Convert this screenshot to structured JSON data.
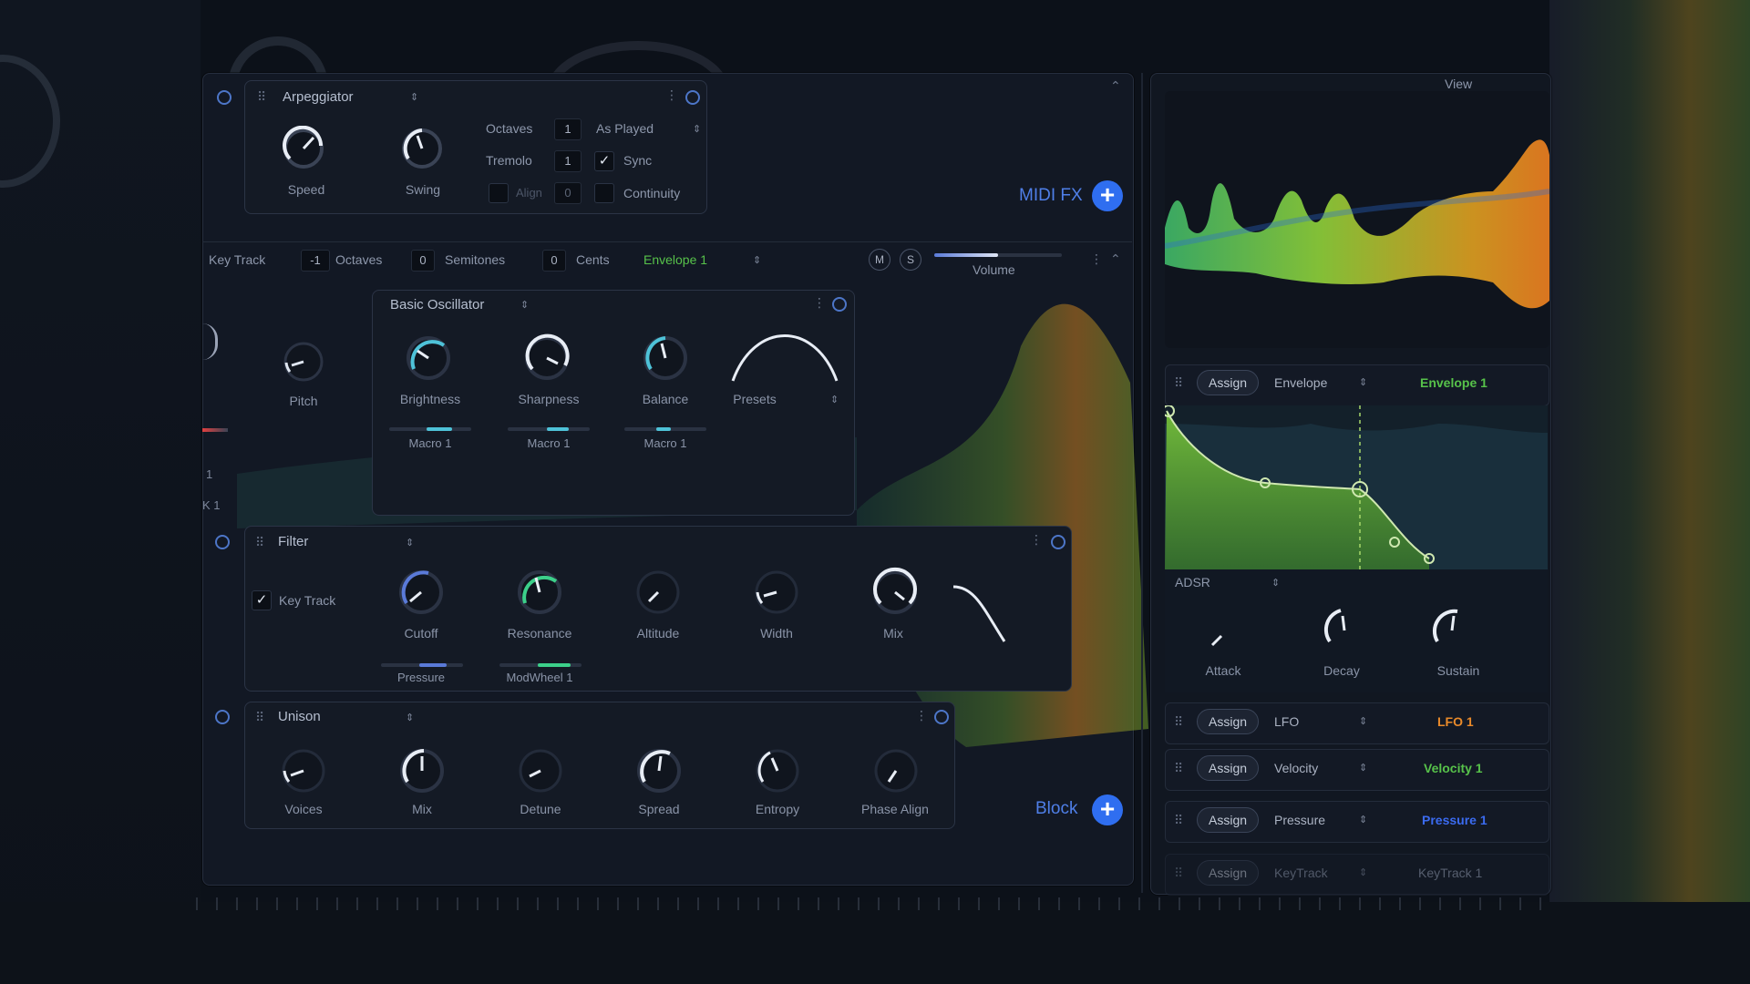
{
  "colors": {
    "accent": "#2f6ef0",
    "green": "#57c24a",
    "orange": "#e98a2a",
    "blue": "#3b6bf0",
    "teal": "#30c8d8"
  },
  "arp": {
    "title": "Arpeggiator",
    "knobs": [
      {
        "label": "Speed"
      },
      {
        "label": "Swing"
      }
    ],
    "octaves_label": "Octaves",
    "octaves_value": "1",
    "mode": "As Played",
    "tremolo_label": "Tremolo",
    "tremolo_value": "1",
    "sync_label": "Sync",
    "align_label": "Align",
    "align_value": "0",
    "continuity_label": "Continuity"
  },
  "midi_fx": {
    "label": "MIDI FX",
    "add_icon": "plus-icon"
  },
  "osc_bar": {
    "key_track": "Key Track",
    "octaves_value": "-1",
    "octaves_label": "Octaves",
    "semitones_value": "0",
    "semitones_label": "Semitones",
    "cents_value": "0",
    "cents_label": "Cents",
    "envelope": "Envelope 1",
    "m": "M",
    "s": "S",
    "volume_label": "Volume"
  },
  "pitch_label": "Pitch",
  "basic_osc": {
    "title": "Basic Oscillator",
    "knobs": [
      {
        "label": "Brightness",
        "macro": "Macro 1"
      },
      {
        "label": "Sharpness",
        "macro": "Macro 1"
      },
      {
        "label": "Balance",
        "macro": "Macro 1"
      }
    ],
    "presets_label": "Presets"
  },
  "filter": {
    "title": "Filter",
    "key_track": "Key Track",
    "knobs": [
      {
        "label": "Cutoff",
        "mod": "Pressure"
      },
      {
        "label": "Resonance",
        "mod": "ModWheel 1"
      },
      {
        "label": "Altitude"
      },
      {
        "label": "Width"
      },
      {
        "label": "Mix"
      }
    ]
  },
  "unison": {
    "title": "Unison",
    "knobs": [
      {
        "label": "Voices"
      },
      {
        "label": "Mix"
      },
      {
        "label": "Detune"
      },
      {
        "label": "Spread"
      },
      {
        "label": "Entropy"
      },
      {
        "label": "Phase Align"
      }
    ]
  },
  "block": {
    "label": "Block",
    "add_icon": "plus-icon"
  },
  "view_label": "View",
  "mod_rows": [
    {
      "assign": "Assign",
      "source": "Envelope",
      "target": "Envelope 1",
      "color": "#57c24a"
    },
    {
      "assign": "Assign",
      "source": "LFO",
      "target": "LFO 1",
      "color": "#e98a2a"
    },
    {
      "assign": "Assign",
      "source": "Velocity",
      "target": "Velocity 1",
      "color": "#57c24a"
    },
    {
      "assign": "Assign",
      "source": "Pressure",
      "target": "Pressure 1",
      "color": "#3b6bf0"
    },
    {
      "assign": "Assign",
      "source": "KeyTrack",
      "target": "KeyTrack 1",
      "color": "#7d879b"
    }
  ],
  "adsr": {
    "title": "ADSR",
    "knobs": [
      {
        "label": "Attack"
      },
      {
        "label": "Decay"
      },
      {
        "label": "Sustain"
      }
    ]
  },
  "bg_partial": {
    "label_a": "1",
    "label_b": "K 1"
  }
}
